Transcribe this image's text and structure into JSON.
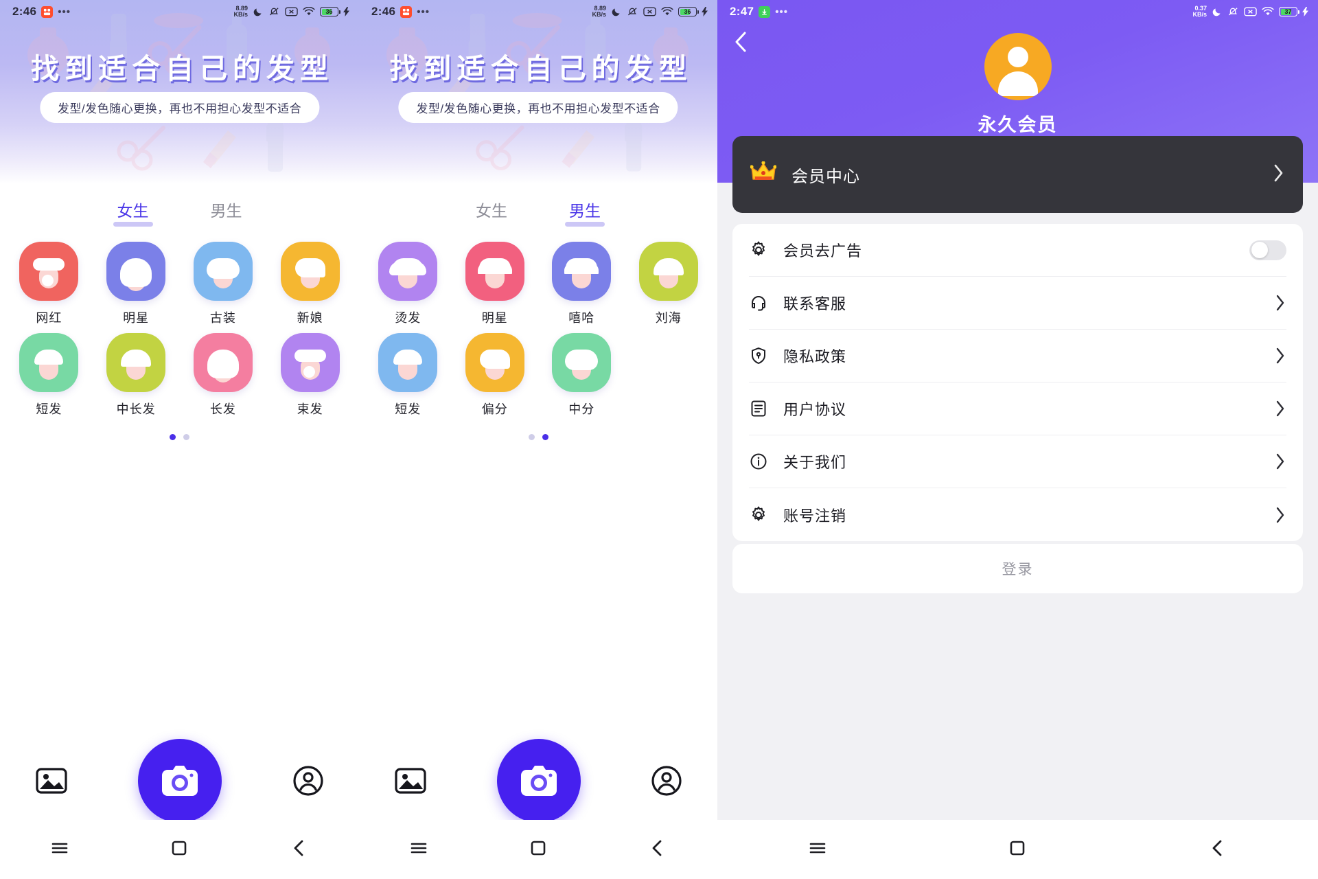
{
  "screen_left": {
    "status": {
      "time": "2:46",
      "app_badge": "app-badge",
      "overflow": "•••",
      "net_speed_value": "8.89",
      "net_speed_unit": "KB/s",
      "battery_percent": "36"
    },
    "banner": {
      "title": "找到适合自己的发型",
      "subtitle": "发型/发色随心更换，再也不用担心发型不适合"
    },
    "tabs": [
      {
        "label": "女生",
        "active": true
      },
      {
        "label": "男生",
        "active": false
      }
    ],
    "hairstyles": [
      {
        "label": "网红",
        "color": "#f0645f",
        "style": "hv-buns"
      },
      {
        "label": "明星",
        "color": "#7b80e8",
        "style": "hv-long"
      },
      {
        "label": "古装",
        "color": "#7fb8ef",
        "style": "hv-bob"
      },
      {
        "label": "新娘",
        "color": "#f5b731",
        "style": "hv-side"
      },
      {
        "label": "短发",
        "color": "#78d9a4",
        "style": "hv-short"
      },
      {
        "label": "中长发",
        "color": "#c2d342",
        "style": "hv-bangs"
      },
      {
        "label": "长发",
        "color": "#f47ea0",
        "style": "hv-long"
      },
      {
        "label": "束发",
        "color": "#b184f0",
        "style": "hv-buns"
      }
    ],
    "pager": {
      "count": 2,
      "active": 0
    },
    "bottom_nav": [
      {
        "name": "gallery",
        "label": "相册"
      },
      {
        "name": "camera",
        "label": "拍照"
      },
      {
        "name": "profile",
        "label": "我的"
      }
    ]
  },
  "screen_middle": {
    "status": {
      "time": "2:46",
      "app_badge": "app-badge",
      "overflow": "•••",
      "net_speed_value": "8.89",
      "net_speed_unit": "KB/s",
      "battery_percent": "36"
    },
    "banner": {
      "title": "找到适合自己的发型",
      "subtitle": "发型/发色随心更换，再也不用担心发型不适合"
    },
    "tabs": [
      {
        "label": "女生",
        "active": false
      },
      {
        "label": "男生",
        "active": true
      }
    ],
    "hairstyles": [
      {
        "label": "烫发",
        "color": "#b184f0",
        "style": "hv-curly"
      },
      {
        "label": "明星",
        "color": "#f2607f",
        "style": "hv-spiky"
      },
      {
        "label": "嘻哈",
        "color": "#7b80e8",
        "style": "hv-spiky"
      },
      {
        "label": "刘海",
        "color": "#c2d342",
        "style": "hv-bangs"
      },
      {
        "label": "短发",
        "color": "#7fb8ef",
        "style": "hv-short"
      },
      {
        "label": "偏分",
        "color": "#f5b731",
        "style": "hv-side"
      },
      {
        "label": "中分",
        "color": "#78d9a4",
        "style": "hv-bob"
      }
    ],
    "pager": {
      "count": 2,
      "active": 1
    },
    "bottom_nav": [
      {
        "name": "gallery",
        "label": "相册"
      },
      {
        "name": "camera",
        "label": "拍照"
      },
      {
        "name": "profile",
        "label": "我的"
      }
    ]
  },
  "screen_right": {
    "status": {
      "time": "2:47",
      "app_badge": "download-badge",
      "overflow": "•••",
      "net_speed_value": "0.37",
      "net_speed_unit": "KB/s",
      "battery_percent": "37"
    },
    "header": {
      "back": "返回",
      "member_title": "永久会员"
    },
    "vip_card": {
      "icon": "crown-icon",
      "label": "会员中心"
    },
    "settings": [
      {
        "icon": "gear-icon",
        "label": "会员去广告",
        "control": "toggle",
        "toggle_on": false
      },
      {
        "icon": "headset-icon",
        "label": "联系客服",
        "control": "chevron"
      },
      {
        "icon": "shield-icon",
        "label": "隐私政策",
        "control": "chevron"
      },
      {
        "icon": "doc-icon",
        "label": "用户协议",
        "control": "chevron"
      },
      {
        "icon": "info-icon",
        "label": "关于我们",
        "control": "chevron"
      },
      {
        "icon": "gear-icon",
        "label": "账号注销",
        "control": "chevron"
      }
    ],
    "login_button": "登录"
  },
  "colors": {
    "accent_purple": "#4620ef",
    "hero_purple": "#7a57f2",
    "vip_card_dark": "#35353b",
    "tab_active": "#4a36e8",
    "banner_gradient_top": "#b3b6f2"
  }
}
